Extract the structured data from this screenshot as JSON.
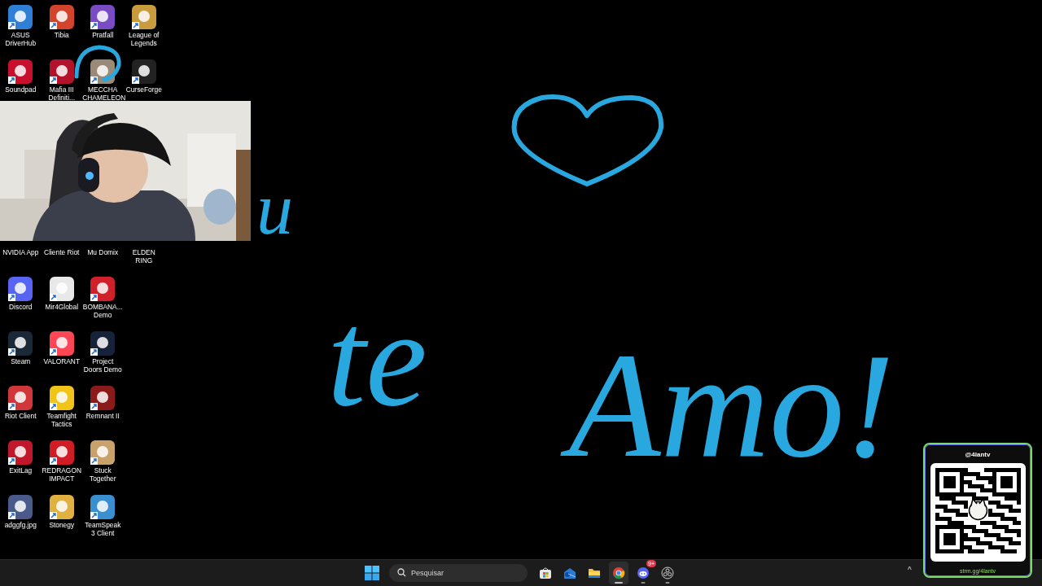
{
  "desktop": {
    "top_rows": [
      [
        {
          "kind": "shortcut",
          "label": "ASUS DriverHub",
          "color": "#2f7fd6"
        },
        {
          "kind": "shortcut",
          "label": "Tibia",
          "color": "#d2452c"
        },
        {
          "kind": "shortcut",
          "label": "Pratfall",
          "color": "#7a4cc4"
        },
        {
          "kind": "shortcut",
          "label": "League of Legends",
          "color": "#c89b3c"
        }
      ],
      [
        {
          "kind": "shortcut",
          "label": "Soundpad",
          "color": "#c8102e"
        },
        {
          "kind": "shortcut",
          "label": "Mafia III Definiti...",
          "color": "#b3122a"
        },
        {
          "kind": "shortcut",
          "label": "MECCHA CHAMELEON",
          "color": "#9c8a78"
        },
        {
          "kind": "shortcut",
          "label": "CurseForge",
          "color": "#222222"
        }
      ]
    ],
    "lower_rows": [
      [
        {
          "kind": "covered",
          "label": "NVIDIA App"
        },
        {
          "kind": "covered",
          "label": "Cliente Riot"
        },
        {
          "kind": "covered",
          "label": "Mu Domix"
        },
        {
          "kind": "covered",
          "label": "ELDEN RING"
        }
      ],
      [
        {
          "kind": "shortcut",
          "label": "Discord",
          "color": "#5865f2"
        },
        {
          "kind": "shortcut",
          "label": "Mir4Global",
          "color": "#e8e8e8"
        },
        {
          "kind": "shortcut",
          "label": "BOMBANA... Demo",
          "color": "#d0202a"
        }
      ],
      [
        {
          "kind": "shortcut",
          "label": "Steam",
          "color": "#1b2838"
        },
        {
          "kind": "shortcut",
          "label": "VALORANT",
          "color": "#ff4655"
        },
        {
          "kind": "shortcut",
          "label": "Project Doors Demo",
          "color": "#16213a"
        }
      ],
      [
        {
          "kind": "shortcut",
          "label": "Riot Client",
          "color": "#d13639"
        },
        {
          "kind": "shortcut",
          "label": "Teamfight Tactics",
          "color": "#f0c419"
        },
        {
          "kind": "shortcut",
          "label": "Remnant II",
          "color": "#8b1a1a"
        }
      ],
      [
        {
          "kind": "shortcut",
          "label": "ExitLag",
          "color": "#c0182a"
        },
        {
          "kind": "shortcut",
          "label": "REDRAGON IMPACT",
          "color": "#d01c24"
        },
        {
          "kind": "shortcut",
          "label": "Stuck Together",
          "color": "#c9a26b"
        }
      ],
      [
        {
          "kind": "shortcut",
          "label": "adggfg.jpg",
          "color": "#4a5a8a"
        },
        {
          "kind": "shortcut",
          "label": "Stonegy",
          "color": "#e0b040"
        },
        {
          "kind": "shortcut",
          "label": "TeamSpeak 3 Client",
          "color": "#3a8fd0"
        }
      ]
    ]
  },
  "drawing": {
    "words": [
      {
        "kind": "small",
        "text": "u"
      },
      {
        "kind": "medium",
        "text": "te"
      },
      {
        "kind": "large",
        "text": "Amo!"
      }
    ]
  },
  "qr_card": {
    "handle": "@4lantv",
    "link": "strm.gg/4lantv"
  },
  "taskbar": {
    "search": {
      "placeholder": "Pesquisar"
    },
    "apps": [
      {
        "kind": "store",
        "selected": false,
        "running": false
      },
      {
        "kind": "mail",
        "selected": false,
        "running": false
      },
      {
        "kind": "folder",
        "selected": false,
        "running": false
      },
      {
        "kind": "browser",
        "selected": true,
        "running": true
      },
      {
        "kind": "chat",
        "selected": false,
        "running": true,
        "badge": "9+"
      },
      {
        "kind": "recorder",
        "selected": false,
        "running": true
      }
    ],
    "tray_caret": "^"
  }
}
